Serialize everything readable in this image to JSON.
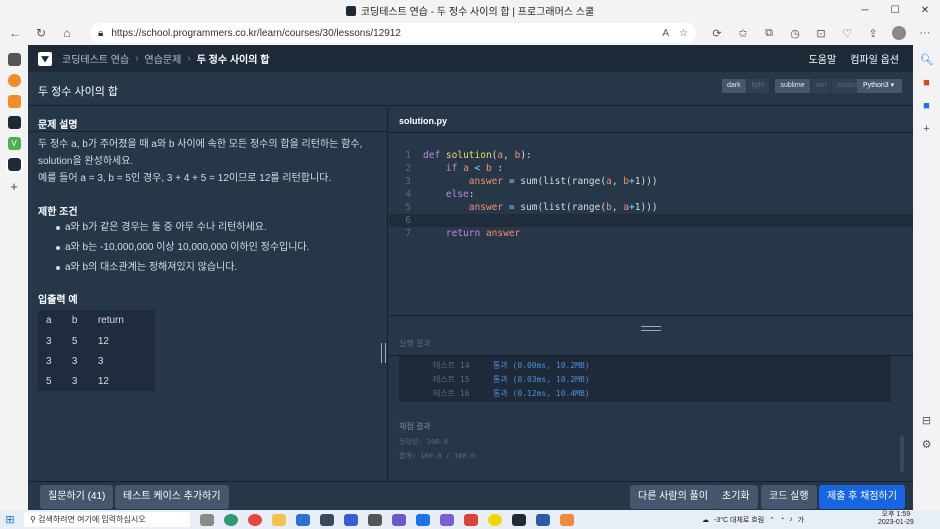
{
  "browser": {
    "window_title": "코딩테스트 연습 - 두 정수 사이의 합 | 프로그래머스 스쿨",
    "url": "https://school.programmers.co.kr/learn/courses/30/lessons/12912"
  },
  "nav": {
    "breadcrumb": [
      "코딩테스트 연습",
      "연습문제",
      "두 정수 사이의 합"
    ],
    "help": "도움말",
    "compile_options": "컴파일 옵션"
  },
  "header": {
    "problem_title": "두 정수 사이의 합",
    "themes": [
      "dark",
      "light",
      "sublime",
      "vim",
      "emacs"
    ],
    "active_themes": [
      "dark",
      "sublime"
    ],
    "language": "Python3 ▾"
  },
  "problem": {
    "description_heading": "문제 설명",
    "description_lines": [
      "두 정수 a, b가 주어졌을 때 a와 b 사이에 속한 모든 정수의 합을 리턴하는 함수,",
      "solution을 완성하세요.",
      "예를 들어 a = 3, b = 5인 경우, 3 + 4 + 5 = 12이므로 12를 리턴합니다."
    ],
    "constraints_heading": "제한 조건",
    "constraints": [
      "a와 b가 같은 경우는 둘 중 아무 수나 리턴하세요.",
      "a와 b는 -10,000,000 이상 10,000,000 이하인 정수입니다.",
      "a와 b의 대소관계는 정해져있지 않습니다."
    ],
    "io_heading": "입출력 예",
    "io_table": {
      "headers": [
        "a",
        "b",
        "return"
      ],
      "rows": [
        [
          "3",
          "5",
          "12"
        ],
        [
          "3",
          "3",
          "3"
        ],
        [
          "5",
          "3",
          "12"
        ]
      ]
    }
  },
  "editor": {
    "filename": "solution.py",
    "line_numbers": [
      "1",
      "2",
      "3",
      "4",
      "5",
      "6",
      "7"
    ],
    "current_line": 6
  },
  "result": {
    "heading": "실행 결과",
    "rows": [
      {
        "name": "테스트 14",
        "status": "통과 (0.00ms, 10.2MB)"
      },
      {
        "name": "테스트 15",
        "status": "통과 (0.03ms, 10.2MB)"
      },
      {
        "name": "테스트 16",
        "status": "통과 (0.12ms, 10.4MB)"
      }
    ],
    "final_heading": "채점 결과",
    "accuracy": "정확성: 100.0",
    "total": "합계: 100.0 / 100.0"
  },
  "footer": {
    "questions": "질문하기 (41)",
    "add_testcase": "테스트 케이스 추가하기",
    "others_solutions": "다른 사람의 풀이",
    "reset": "초기화",
    "run": "코드 실행",
    "submit": "제출 후 채점하기"
  },
  "taskbar": {
    "search_placeholder": "검색하려면 여기에 입력하십시오",
    "weather": "-3°C 대체로 흐림",
    "time": "오후 1:59",
    "date": "2023-01-29"
  },
  "colors": {
    "page_bg": "#263747",
    "nav_bg": "#1e2a38",
    "primary_button": "#1565e5",
    "pass_text": "#4a8ee0",
    "keyword": "#c586e0",
    "function": "#f5d76e",
    "variable": "#f78c6c"
  }
}
